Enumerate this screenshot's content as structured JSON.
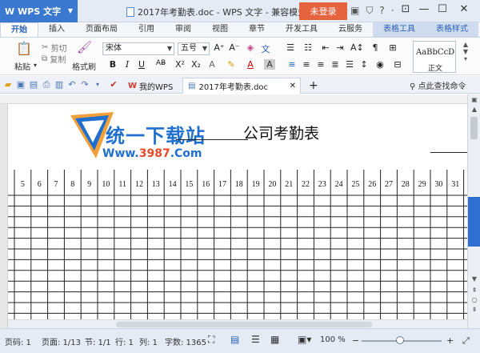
{
  "titlebar": {
    "app_name": "WPS 文字",
    "app_logo": "W",
    "doc_title": "2017年考勤表.doc - WPS 文字 - 兼容模式",
    "login_button": "未登录"
  },
  "ribbon_tabs": [
    "开始",
    "插入",
    "页面布局",
    "引用",
    "审阅",
    "视图",
    "章节",
    "开发工具",
    "云服务",
    "表格工具",
    "表格样式"
  ],
  "ribbon": {
    "paste_label": "粘贴",
    "cut_label": "剪切",
    "copy_label": "复制",
    "format_painter_label": "格式刷",
    "font_name": "宋体",
    "font_size": "五号",
    "style_preview": "AaBbCcD",
    "style_name": "正文"
  },
  "quickbar": {
    "mywps_tab": "我的WPS",
    "doc_tab": "2017年考勤表.doc",
    "add_tab": "+",
    "search_cmd": "点此查找命令"
  },
  "document": {
    "watermark_text": "统一下载站",
    "watermark_url_prefix": "Www.",
    "watermark_url_number": "3987",
    "watermark_url_suffix": ".Com",
    "heading": "公司考勤表",
    "day_columns": [
      "5",
      "6",
      "7",
      "8",
      "9",
      "10",
      "11",
      "12",
      "13",
      "14",
      "15",
      "16",
      "17",
      "18",
      "19",
      "20",
      "21",
      "22",
      "23",
      "24",
      "25",
      "26",
      "27",
      "28",
      "29",
      "30",
      "31"
    ]
  },
  "statusbar": {
    "page_num": "页码: 1",
    "pages": "页面: 1/13",
    "section": "节: 1/1",
    "row": "行: 1",
    "col": "列: 1",
    "word_count": "字数: 1365",
    "zoom": "100 %",
    "zoom_value_percent": 100
  },
  "colors": {
    "accent": "#3b78d0",
    "login": "#e5633f",
    "watermark_blue": "#1e6fd0",
    "watermark_red": "#e54b2a"
  }
}
